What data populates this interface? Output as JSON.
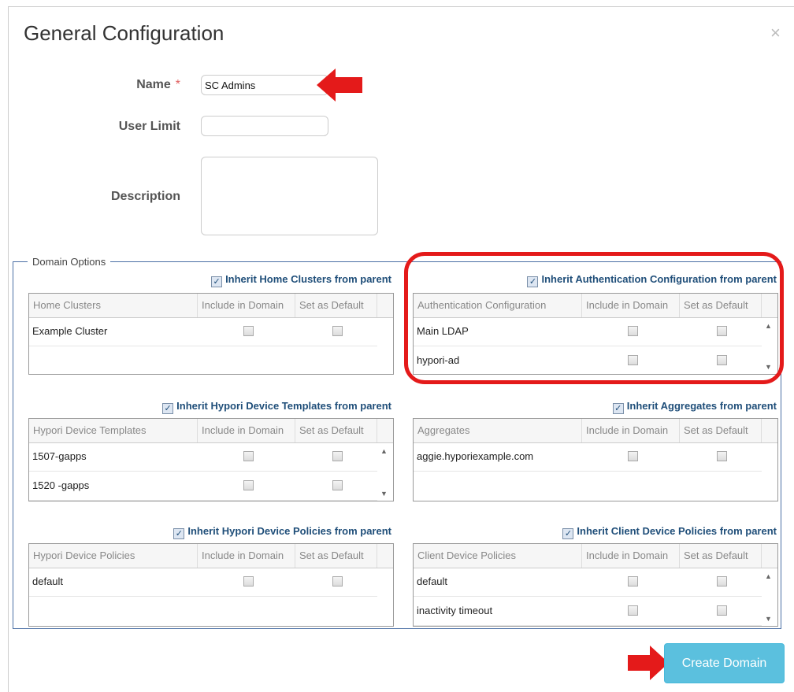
{
  "dialog": {
    "title": "General Configuration",
    "close_glyph": "×"
  },
  "form": {
    "name_label": "Name",
    "required_mark": "*",
    "name_value": "SC Admins",
    "user_limit_label": "User Limit",
    "user_limit_value": "",
    "description_label": "Description",
    "description_value": ""
  },
  "domain_options": {
    "legend": "Domain Options",
    "panels": {
      "home_clusters": {
        "inherit_label": "Inherit Home Clusters from parent",
        "inherit_checked": true,
        "columns": [
          "Home Clusters",
          "Include in Domain",
          "Set as Default"
        ],
        "rows": [
          {
            "name": "Example Cluster",
            "include": false,
            "default": false
          }
        ]
      },
      "auth_config": {
        "inherit_label": "Inherit Authentication Configuration from parent",
        "inherit_checked": true,
        "columns": [
          "Authentication Configuration",
          "Include in Domain",
          "Set as Default"
        ],
        "rows": [
          {
            "name": "Main LDAP",
            "include": false,
            "default": false
          },
          {
            "name": "hypori-ad",
            "include": false,
            "default": false
          }
        ]
      },
      "device_templates": {
        "inherit_label": "Inherit Hypori Device Templates from parent",
        "inherit_checked": true,
        "columns": [
          "Hypori Device Templates",
          "Include in Domain",
          "Set as Default"
        ],
        "rows": [
          {
            "name": "1507-gapps",
            "include": false,
            "default": false
          },
          {
            "name": "1520 -gapps",
            "include": false,
            "default": false
          }
        ]
      },
      "aggregates": {
        "inherit_label": "Inherit Aggregates from parent",
        "inherit_checked": true,
        "columns": [
          "Aggregates",
          "Include in Domain",
          "Set as Default"
        ],
        "rows": [
          {
            "name": "aggie.hyporiexample.com",
            "include": false,
            "default": false
          }
        ]
      },
      "device_policies": {
        "inherit_label": "Inherit Hypori Device Policies from parent",
        "inherit_checked": true,
        "columns": [
          "Hypori Device Policies",
          "Include in Domain",
          "Set as Default"
        ],
        "rows": [
          {
            "name": "default",
            "include": false,
            "default": false
          }
        ]
      },
      "client_policies": {
        "inherit_label": "Inherit Client Device Policies from parent",
        "inherit_checked": true,
        "columns": [
          "Client Device Policies",
          "Include in Domain",
          "Set as Default"
        ],
        "rows": [
          {
            "name": "default",
            "include": false,
            "default": false
          },
          {
            "name": "inactivity timeout",
            "include": false,
            "default": false
          }
        ]
      }
    }
  },
  "footer": {
    "create_label": "Create Domain"
  },
  "colors": {
    "annotation_red": "#e41a1a",
    "button_blue": "#5bc0de",
    "inherit_text": "#1f4e79",
    "fieldset_border": "#4a6fa5"
  },
  "icons": {
    "check": "check-icon",
    "scroll_up": "scroll-up-arrow-icon",
    "scroll_down": "scroll-down-arrow-icon",
    "close": "close-icon",
    "annotation_arrow": "red-arrow-icon"
  }
}
